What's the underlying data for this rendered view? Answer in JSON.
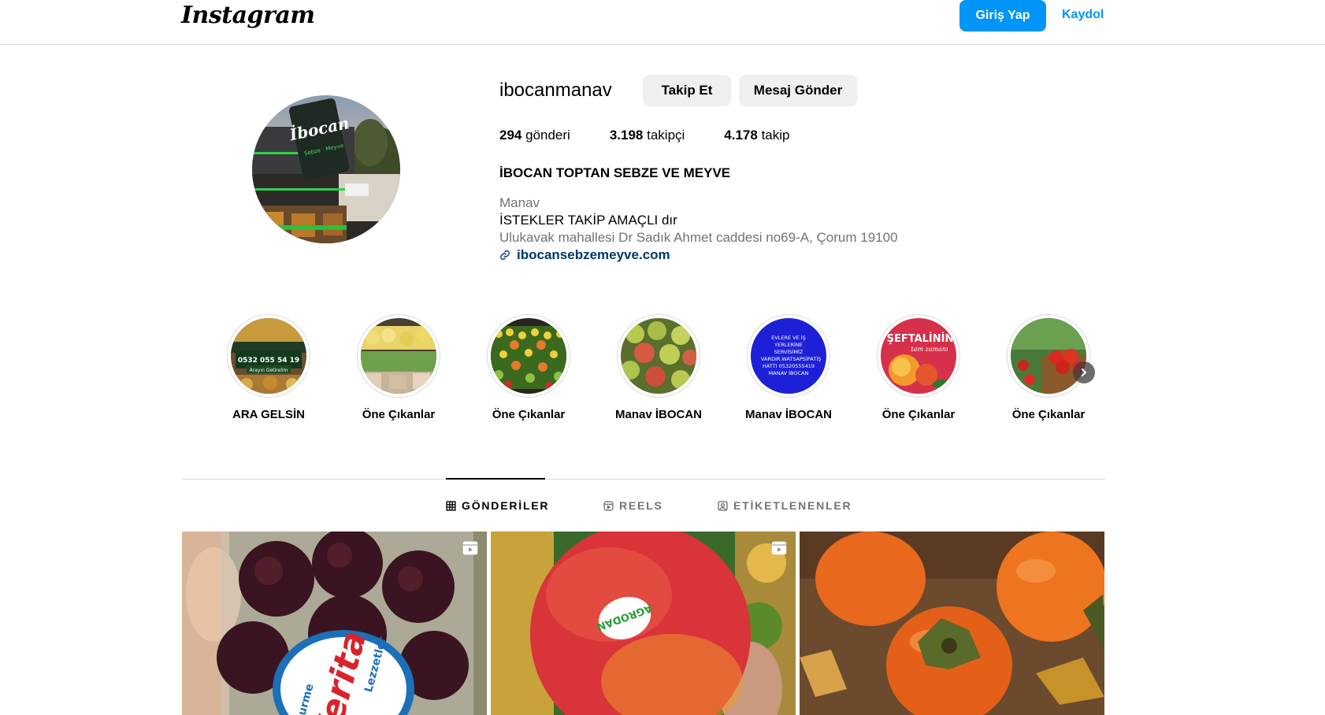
{
  "nav": {
    "logo": "Instagram",
    "login_label": "Giriş Yap",
    "signup_label": "Kaydol"
  },
  "profile": {
    "username": "ibocanmanav",
    "follow_label": "Takip Et",
    "message_label": "Mesaj Gönder",
    "stats": {
      "posts_count": "294",
      "posts_label": "gönderi",
      "followers_count": "3.198",
      "followers_label": "takipçi",
      "following_count": "4.178",
      "following_label": "takip"
    },
    "full_name": "İBOCAN TOPTAN SEBZE VE MEYVE",
    "category": "Manav",
    "bio": "İSTEKLER TAKİP AMAÇLI dır",
    "address": "Ulukavak mahallesi Dr Sadık Ahmet caddesi no69-A, Çorum 19100",
    "website": "ibocansebzemeyve.com"
  },
  "highlights": [
    {
      "label": "ARA GELSİN"
    },
    {
      "label": "Öne Çıkanlar"
    },
    {
      "label": "Öne Çıkanlar"
    },
    {
      "label": "Manav İBOCAN"
    },
    {
      "label": "Manav İBOCAN"
    },
    {
      "label": "Öne Çıkanlar"
    },
    {
      "label": "Öne Çıkanlar"
    }
  ],
  "highlight_texts": {
    "h1_line1": "0532 055 54 19",
    "h1_line2": "Arayın Getirelim",
    "h5_text": "EVLERE VE İŞ YERLERİNE SERVİSİMİZ VARDIR.WATSAPSİPATİŞ HATTI 05320555419 MANAV İBOCAN",
    "h6_line1": "ŞEFTALİNİN",
    "h6_line2": "tam zamanı"
  },
  "tabs": [
    {
      "label": "GÖNDERİLER",
      "active": true
    },
    {
      "label": "REELS",
      "active": false
    },
    {
      "label": "ETİKETLENENLER",
      "active": false
    }
  ],
  "posts": [
    {
      "type": "reel",
      "brand": "Verita",
      "sub_left": "Gurme",
      "sub_right": "Lezzetler"
    },
    {
      "type": "reel",
      "sticker": "AGRODAN"
    },
    {
      "type": "photo"
    }
  ],
  "colors": {
    "primary": "#0095f6",
    "link": "#00376b",
    "secondary_text": "#737373",
    "button_gray": "#efefef",
    "divider": "#dbdbdb"
  },
  "icons": {
    "link": "link-icon",
    "grid": "grid-icon",
    "reels": "reels-icon",
    "tagged": "tagged-icon",
    "next": "chevron-right-icon",
    "reel_badge": "reel-badge-icon"
  }
}
